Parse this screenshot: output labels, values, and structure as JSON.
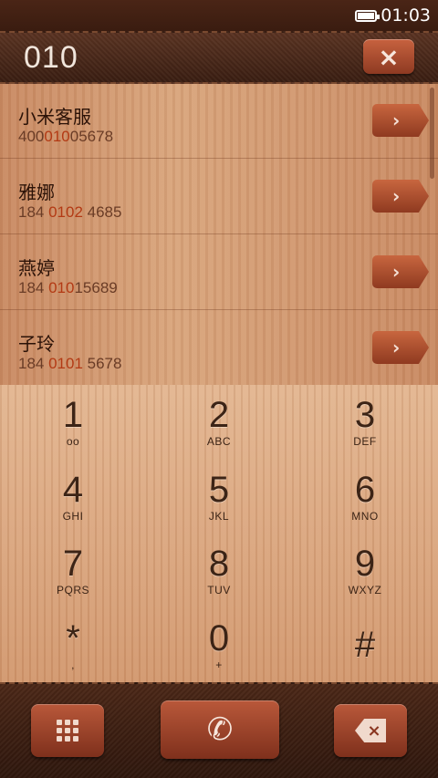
{
  "status_bar": {
    "time": "01:03"
  },
  "header": {
    "dialed_number": "010",
    "clear_label": "×"
  },
  "results": [
    {
      "name": "小米客服",
      "number_pre": "400",
      "number_match": "010",
      "number_post": "05678"
    },
    {
      "name": "雅娜",
      "number_pre": "184 ",
      "number_match": "0102",
      "number_post": " 4685"
    },
    {
      "name": "燕婷",
      "number_pre": "184 ",
      "number_match": "010",
      "number_post": "15689"
    },
    {
      "name": "子玲",
      "number_pre": "184 ",
      "number_match": "0101",
      "number_post": " 5678"
    }
  ],
  "result_button_glyph": "›",
  "keypad": [
    {
      "digit": "1",
      "letters": "oo"
    },
    {
      "digit": "2",
      "letters": "ABC"
    },
    {
      "digit": "3",
      "letters": "DEF"
    },
    {
      "digit": "4",
      "letters": "GHI"
    },
    {
      "digit": "5",
      "letters": "JKL"
    },
    {
      "digit": "6",
      "letters": "MNO"
    },
    {
      "digit": "7",
      "letters": "PQRS"
    },
    {
      "digit": "8",
      "letters": "TUV"
    },
    {
      "digit": "9",
      "letters": "WXYZ"
    },
    {
      "digit": "*",
      "letters": ","
    },
    {
      "digit": "0",
      "letters": "+"
    },
    {
      "digit": "#",
      "letters": ""
    }
  ],
  "bottom_bar": {
    "call_glyph": "✆",
    "backspace_glyph": "×"
  },
  "colors": {
    "accent": "#b33a14",
    "leather": "#4b2717",
    "wood": "#d9a57c"
  }
}
